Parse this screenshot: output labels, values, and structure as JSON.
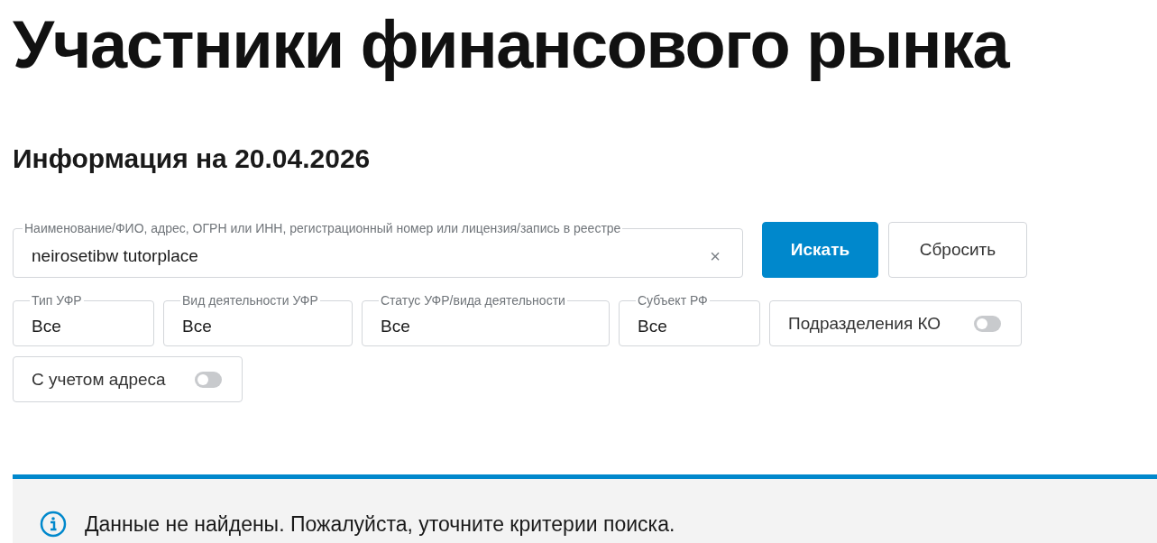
{
  "page_title": "Участники финансового рынка",
  "info_heading": "Информация на 20.04.2026",
  "search": {
    "label": "Наименование/ФИО, адрес, ОГРН или ИНН, регистрационный номер или лицензия/запись в реестре",
    "value": "neirosetibw tutorplace",
    "clear": "×"
  },
  "buttons": [
    {
      "label": "Искать",
      "kind": "primary"
    },
    {
      "label": "Сбросить",
      "kind": "secondary"
    }
  ],
  "filters": [
    {
      "kind": "select",
      "label": "Тип УФР",
      "value": "Все"
    },
    {
      "kind": "select",
      "label": "Вид деятельности УФР",
      "value": "Все"
    },
    {
      "kind": "select",
      "label": "Статус УФР/вида деятельности",
      "value": "Все"
    },
    {
      "kind": "select",
      "label": "Субъект РФ",
      "value": "Все"
    },
    {
      "kind": "toggle",
      "label": "Подразделения КО",
      "on": false
    },
    {
      "kind": "toggle",
      "label": "С учетом адреса",
      "on": false
    }
  ],
  "alert": {
    "text": "Данные не найдены. Пожалуйста, уточните критерии поиска."
  }
}
